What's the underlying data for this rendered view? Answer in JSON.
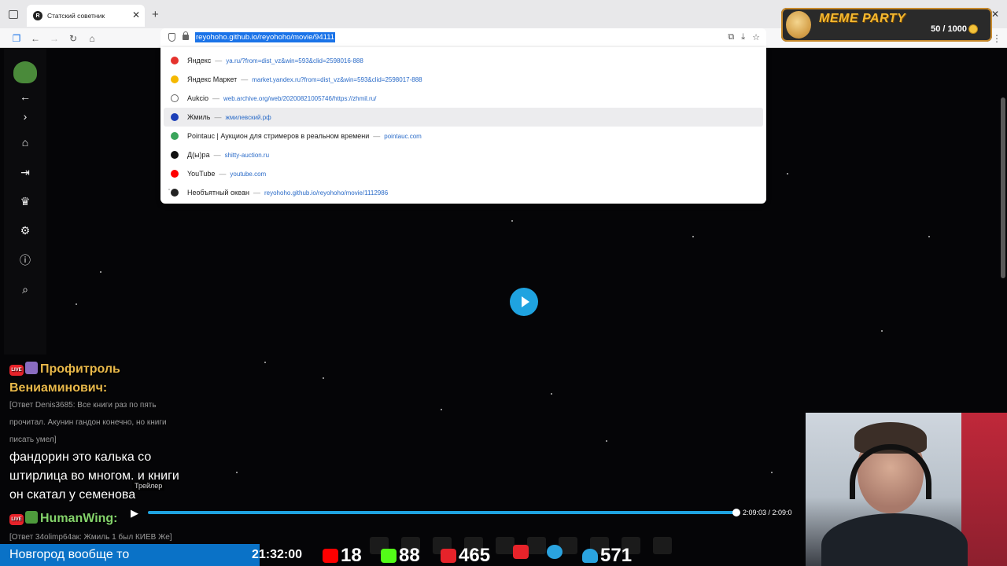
{
  "browser": {
    "tab_title": "Статский советник",
    "tab_favicon": "R",
    "new_tab": "+",
    "tab_close": "✕",
    "url": "reyohoho.github.io/reyohoho/movie/94111",
    "window_controls": [
      "⌄",
      "—",
      "❐",
      "✕"
    ]
  },
  "suggestions": [
    {
      "title": "Яндекс",
      "url": "ya.ru/?from=dist_vz&win=593&clid=2598016-888",
      "color": "#e5322d",
      "hover": false
    },
    {
      "title": "Яндекс Маркет",
      "url": "market.yandex.ru?from=dist_vz&win=593&clid=2598017-888",
      "color": "#f5b800",
      "hover": false
    },
    {
      "title": "Aukcio",
      "url": "web.archive.org/web/20200821005746/https://zhmil.ru/",
      "color": "#ffffff",
      "hover": false
    },
    {
      "title": "Жмиль",
      "url": "жмилевский.рф",
      "color": "#1c3fb8",
      "hover": true
    },
    {
      "title": "Pointauc | Аукцион для стримеров в реальном времени",
      "url": "pointauc.com",
      "color": "#3aa55b",
      "hover": false
    },
    {
      "title": "Д(ы)ра",
      "url": "shitty-auction.ru",
      "color": "#111111",
      "hover": false
    },
    {
      "title": "YouTube",
      "url": "youtube.com",
      "color": "#ff0000",
      "hover": false
    },
    {
      "title": "Необъятный океан",
      "url": "reyohoho.github.io/reyohoho/movie/1112986",
      "color": "#222222",
      "hover": false
    }
  ],
  "extension": {
    "title": "MEME PARTY",
    "count": "50 / 1000"
  },
  "nav": {
    "items": [
      "back-arrow-icon",
      "forward-chevron-icon",
      "home-icon",
      "login-icon",
      "trophy-icon",
      "settings-icon",
      "info-icon",
      "search-icon"
    ]
  },
  "player": {
    "trailer_label": "Трейлер",
    "timecode": "2:09:03 / 2:09:0",
    "progress": 1.0,
    "accent": "#1fa3e0"
  },
  "chat": {
    "msg1_author_line1": "Профитроль",
    "msg1_author_line2": "Вениаминович:",
    "msg1_reply_line1": "[Ответ Denis3685: Все книги раз по пять",
    "msg1_reply_line2": "прочитал. Акунин гандон конечно, но книги",
    "msg1_reply_line3": "писать умел]",
    "msg1_text_line1": "фандорин это калька со",
    "msg1_text_line2": "штирлица во многом. и книги",
    "msg1_text_line3": "он скатал у семенова",
    "msg2_author": "HumanWing:",
    "msg2_reply": "[Ответ 34olimp64ак: Жмиль 1 был КИЕВ Же]",
    "live_label": "LIVE"
  },
  "stats": {
    "news": "Новгород вообще то",
    "clock": "21:32:00",
    "youtube": "18",
    "kick": "88",
    "live": "465",
    "viewers": "571"
  }
}
